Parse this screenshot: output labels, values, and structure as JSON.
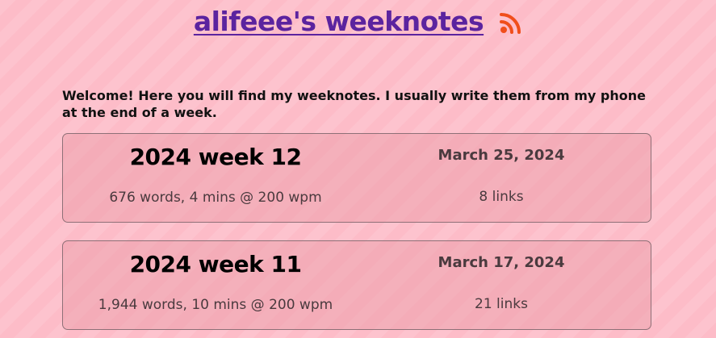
{
  "header": {
    "title": "alifeee's weeknotes",
    "rss_icon": "rss-feed-icon",
    "title_color": "#5b239f",
    "rss_color": "#f04e1b"
  },
  "welcome_text": "Welcome! Here you will find my weeknotes. I usually write them from my phone at the end of a week.",
  "weeknotes": [
    {
      "title": "2024 week 12",
      "date": "March 25, 2024",
      "stats": "676 words, 4 mins @ 200 wpm",
      "links": "8 links"
    },
    {
      "title": "2024 week 11",
      "date": "March 17, 2024",
      "stats": "1,944 words, 10 mins @ 200 wpm",
      "links": "21 links"
    }
  ],
  "colors": {
    "background": "#fdbcc8",
    "card_border": "#8e7077"
  }
}
